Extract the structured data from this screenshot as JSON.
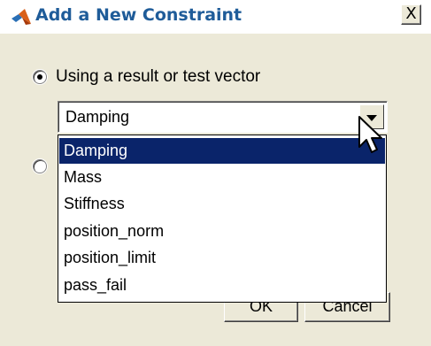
{
  "dialog": {
    "title": "Add a New Constraint",
    "close_glyph": "X"
  },
  "options": {
    "result_vector_label": "Using a result or test vector",
    "result_vector_selected": true,
    "second_option_selected": false
  },
  "combo": {
    "selected_value": "Damping",
    "items": [
      "Damping",
      "Mass",
      "Stiffness",
      "position_norm",
      "position_limit",
      "pass_fail"
    ],
    "highlighted_index": 0
  },
  "buttons": {
    "ok_label": "OK",
    "cancel_label": "Cancel"
  },
  "colors": {
    "title_text": "#1f5c99",
    "dialog_face": "#ece9d8",
    "selection_highlight": "#0a246a"
  },
  "icons": {
    "app": "matlab-logo-icon",
    "close": "close-icon",
    "dropdown": "chevron-down-icon",
    "pointer": "mouse-cursor-icon"
  }
}
